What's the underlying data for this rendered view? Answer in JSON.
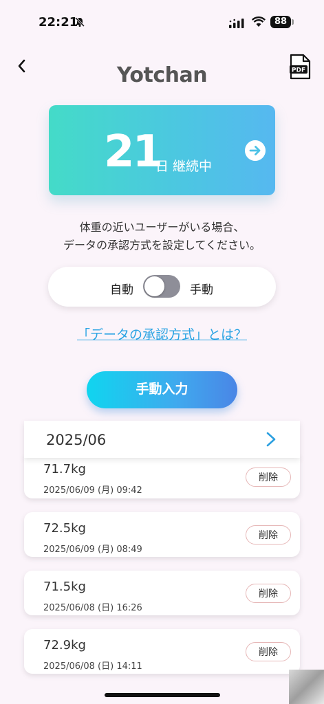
{
  "status": {
    "time": "22:21",
    "battery": "88"
  },
  "header": {
    "title": "Yotchan",
    "pdf_label": "PDF"
  },
  "streak": {
    "number": "21",
    "label": "日 継続中"
  },
  "description": {
    "line1": "体重の近いユーザーがいる場合、",
    "line2": "データの承認方式を設定してください。"
  },
  "approval_toggle": {
    "left_label": "自動",
    "right_label": "手動",
    "is_on": false
  },
  "help_link": "「データの承認方式」とは？",
  "manual_button": "手動入力",
  "month": {
    "label": "2025/06"
  },
  "entries": [
    {
      "weight": "71.7kg",
      "date": "2025/06/09 (月) 09:42",
      "delete_label": "削除"
    },
    {
      "weight": "72.5kg",
      "date": "2025/06/09 (月) 08:49",
      "delete_label": "削除"
    },
    {
      "weight": "71.5kg",
      "date": "2025/06/08 (日) 16:26",
      "delete_label": "削除"
    },
    {
      "weight": "72.9kg",
      "date": "2025/06/08 (日) 14:11",
      "delete_label": "削除"
    }
  ],
  "colors": {
    "accent": "#29a3e3",
    "streak_start": "#44dbc8",
    "streak_end": "#56b8f0"
  }
}
